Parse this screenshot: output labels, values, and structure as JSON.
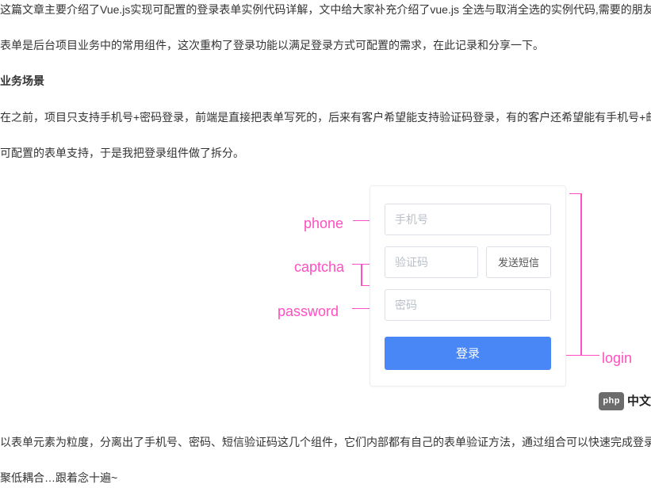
{
  "article": {
    "intro": "这篇文章主要介绍了Vue.js实现可配置的登录表单实例代码详解，文中给大家补充介绍了vue.js 全选与取消全选的实例代码,需要的朋友",
    "para1": "表单是后台项目业务中的常用组件，这次重构了登录功能以满足登录方式可配置的需求，在此记录和分享一下。",
    "section_heading": "业务场景",
    "para2": "在之前，项目只支持手机号+密码登录，前端是直接把表单写死的，后来有客户希望能支持验证码登录，有的客户还希望能有手机号+邮",
    "para3": "可配置的表单支持，于是我把登录组件做了拆分。",
    "para4": "以表单元素为粒度，分离出了手机号、密码、短信验证码这几个组件，它们内部都有自己的表单验证方法，通过组合可以快速完成登录",
    "para5": "聚低耦合…跟着念十遍~"
  },
  "annotations": {
    "phone": "phone",
    "captcha": "captcha",
    "password": "password",
    "login": "login"
  },
  "form": {
    "phone_placeholder": "手机号",
    "captcha_placeholder": "验证码",
    "send_sms_label": "发送短信",
    "password_placeholder": "密码",
    "login_label": "登录"
  },
  "logo": {
    "pill": "php",
    "brand": "中文"
  }
}
